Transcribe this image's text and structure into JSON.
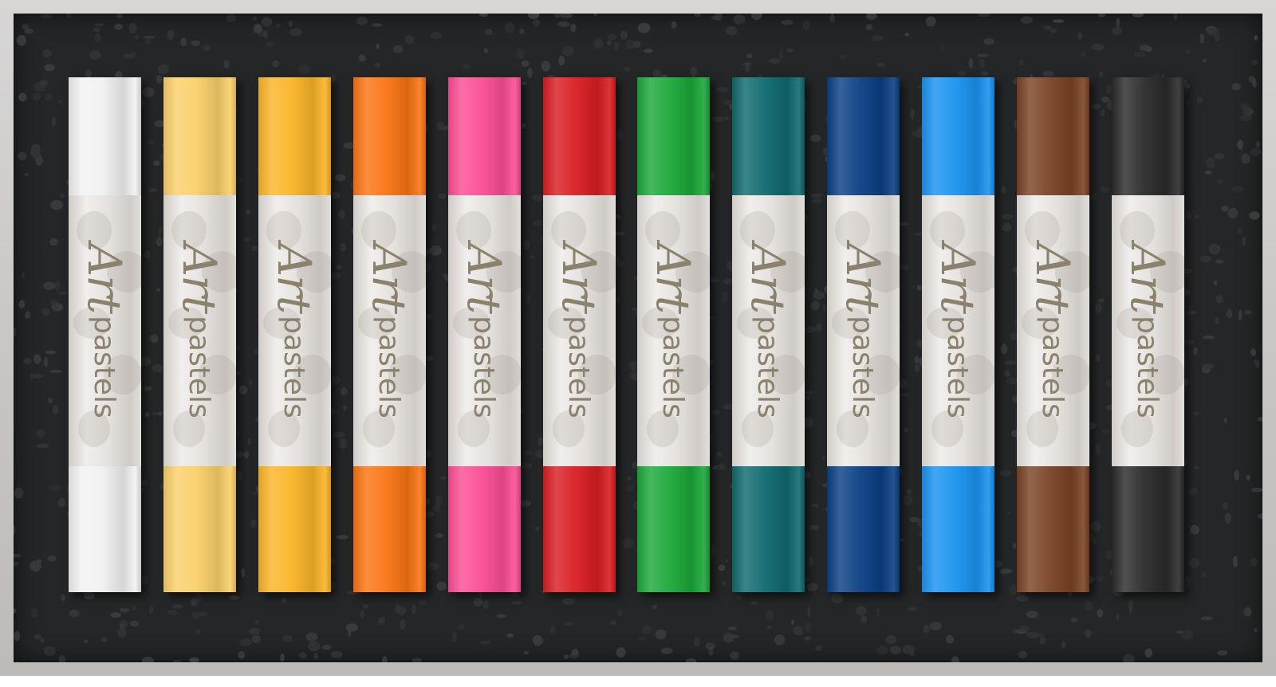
{
  "brand": {
    "script": "Art",
    "word": "pastels"
  },
  "pastels": [
    {
      "color": "#f2f2f2",
      "icon": "white-pastel"
    },
    {
      "color": "#fbd06a",
      "icon": "light-yellow-pastel"
    },
    {
      "color": "#fbb527",
      "icon": "yellow-pastel"
    },
    {
      "color": "#fb7413",
      "icon": "orange-pastel"
    },
    {
      "color": "#fb4d94",
      "icon": "pink-pastel"
    },
    {
      "color": "#d91d22",
      "icon": "red-pastel"
    },
    {
      "color": "#1ca83a",
      "icon": "green-pastel"
    },
    {
      "color": "#0e6a6e",
      "icon": "teal-pastel"
    },
    {
      "color": "#0b3f84",
      "icon": "navy-blue-pastel"
    },
    {
      "color": "#1a93f0",
      "icon": "sky-blue-pastel"
    },
    {
      "color": "#7a4325",
      "icon": "brown-pastel"
    },
    {
      "color": "#2a2a2a",
      "icon": "black-pastel"
    }
  ],
  "colors": {
    "tray": "#242627",
    "frame": "#cfcccb",
    "label_text": "#8a826c"
  }
}
